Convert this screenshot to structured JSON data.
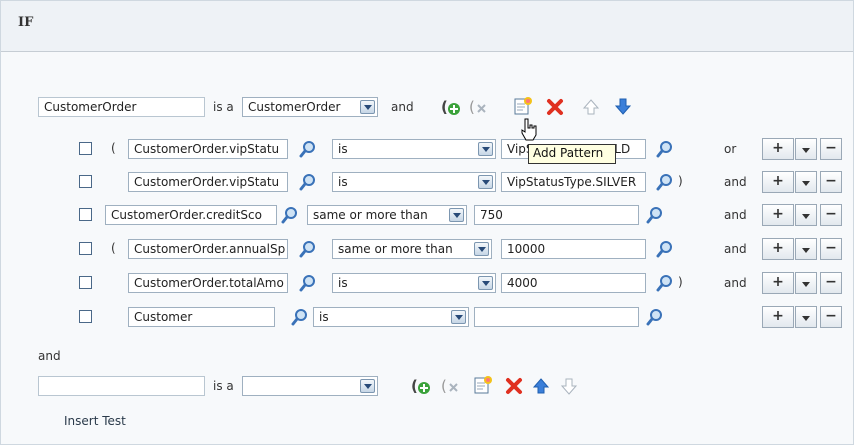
{
  "header": {
    "title": "IF"
  },
  "pattern": {
    "variable": "CustomerOrder",
    "is_a_label": "is a",
    "type_value": "CustomerOrder",
    "and_label": "and"
  },
  "rows": [
    {
      "paren_open": "(",
      "left": "CustomerOrder.vipStatu",
      "op": "is",
      "right": "VipStatusType.GOLD",
      "paren_close": "",
      "conj": "or"
    },
    {
      "paren_open": "",
      "left": "CustomerOrder.vipStatu",
      "op": "is",
      "right": "VipStatusType.SILVER",
      "paren_close": ")",
      "conj": "and"
    },
    {
      "paren_open": "",
      "left": "CustomerOrder.creditSco",
      "op": "same or more than",
      "right": "750",
      "paren_close": "",
      "conj": "and"
    },
    {
      "paren_open": "(",
      "left": "CustomerOrder.annualSp",
      "op": "same or more than",
      "right": "10000",
      "paren_close": "",
      "conj": "and"
    },
    {
      "paren_open": "",
      "left": "CustomerOrder.totalAmo",
      "op": "is",
      "right": "4000",
      "paren_close": ")",
      "conj": "and"
    },
    {
      "paren_open": "",
      "left": "Customer",
      "op": "is",
      "right": "",
      "paren_close": "",
      "conj": ""
    }
  ],
  "row_buttons": {
    "add": "+",
    "remove": "−"
  },
  "between_and": "and",
  "pattern2": {
    "variable": "",
    "is_a_label": "is a",
    "type_value": ""
  },
  "insert_test": "Insert Test",
  "tooltip": "Add Pattern",
  "icons": [
    "add-test-group-icon",
    "remove-test-group-icon",
    "add-pattern-icon",
    "delete-icon",
    "move-up-icon",
    "move-down-icon",
    "search-icon"
  ],
  "colors": {
    "add_green": "#3aa23a",
    "delete_red": "#e03020",
    "arrow_blue": "#3b7fd9",
    "tooltip_bg": "#ffffe1"
  }
}
